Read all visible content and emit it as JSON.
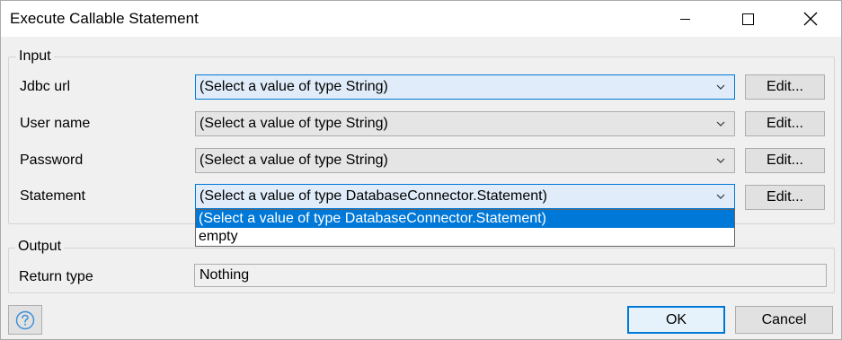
{
  "window": {
    "title": "Execute Callable Statement",
    "minimize_icon": "minimize-icon",
    "maximize_icon": "maximize-icon",
    "close_icon": "close-icon"
  },
  "input_group": {
    "legend": "Input",
    "fields": [
      {
        "label": "Jdbc url",
        "value": "(Select a value of type String)",
        "edit_label": "Edit..."
      },
      {
        "label": "User name",
        "value": "(Select a value of type String)",
        "edit_label": "Edit..."
      },
      {
        "label": "Password",
        "value": "(Select a value of type String)",
        "edit_label": "Edit..."
      },
      {
        "label": "Statement",
        "value": "(Select a value of type DatabaseConnector.Statement)",
        "edit_label": "Edit..."
      }
    ],
    "dropdown_options": [
      "(Select a value of type DatabaseConnector.Statement)",
      "empty"
    ]
  },
  "output_group": {
    "legend": "Output",
    "return_type_label": "Return type",
    "return_type_value": "Nothing"
  },
  "footer": {
    "help_icon": "help-icon",
    "ok_label": "OK",
    "cancel_label": "Cancel"
  },
  "colors": {
    "accent": "#0078d7",
    "focused_field_bg": "#e0ecf9"
  }
}
